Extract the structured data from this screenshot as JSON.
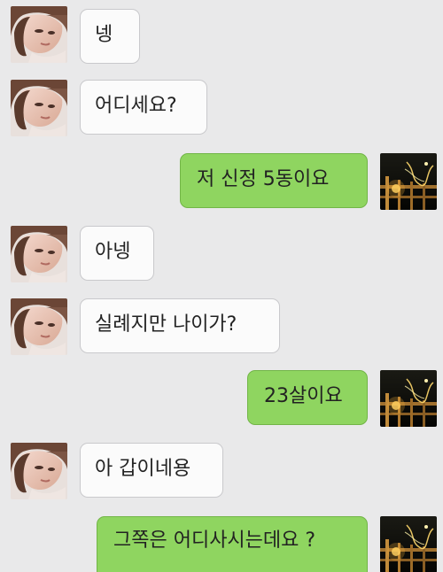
{
  "conversation": {
    "messages": [
      {
        "side": "in",
        "text": "넹",
        "avatar": "woman-profile-photo"
      },
      {
        "side": "in",
        "text": "어디세요?",
        "avatar": "woman-profile-photo"
      },
      {
        "side": "out",
        "text": "저 신정 5동이요",
        "avatar": "night-fence-lights-photo"
      },
      {
        "side": "in",
        "text": "아넹",
        "avatar": "woman-profile-photo"
      },
      {
        "side": "in",
        "text": "실례지만 나이가?",
        "avatar": "woman-profile-photo"
      },
      {
        "side": "out",
        "text": "23살이요",
        "avatar": "night-fence-lights-photo"
      },
      {
        "side": "in",
        "text": "아 갑이네용",
        "avatar": "woman-profile-photo"
      },
      {
        "side": "out",
        "text": "그쪽은 어디사시는데요 ?",
        "avatar": "night-fence-lights-photo"
      }
    ]
  },
  "colors": {
    "background": "#e9e9ea",
    "incoming_bubble": "#fbfbfb",
    "outgoing_bubble": "#8fd560"
  }
}
